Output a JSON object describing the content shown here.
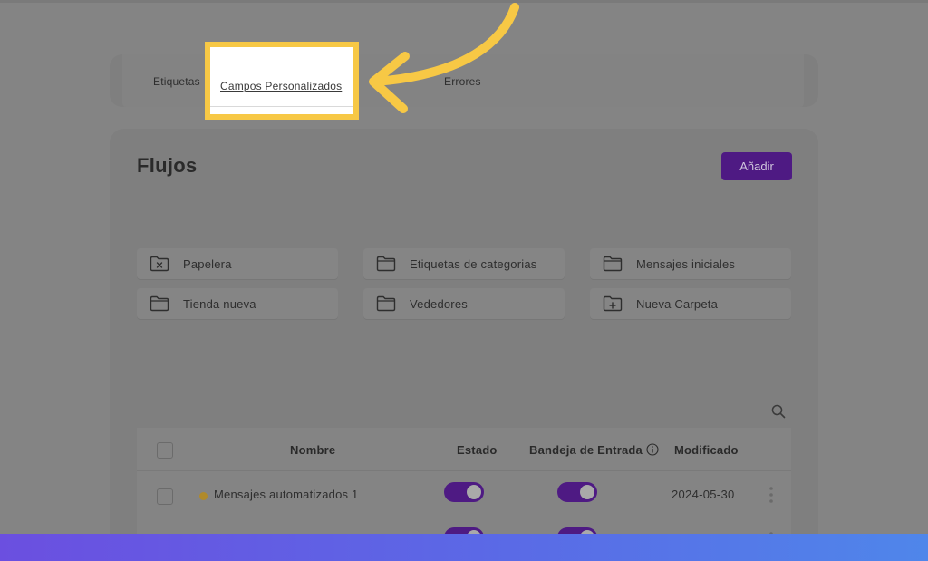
{
  "tabs": {
    "items": [
      {
        "label": "Etiquetas"
      },
      {
        "label": "Campos Personalizados"
      },
      {
        "label": "Errores"
      }
    ],
    "highlighted": "Campos Personalizados"
  },
  "main": {
    "title": "Flujos",
    "add_label": "Añadir",
    "folders": [
      {
        "label": "Papelera",
        "icon": "folder-x-icon"
      },
      {
        "label": "Etiquetas de categorias",
        "icon": "folder-icon"
      },
      {
        "label": "Mensajes iniciales",
        "icon": "folder-icon"
      },
      {
        "label": "Tienda nueva",
        "icon": "folder-icon"
      },
      {
        "label": "Vededores",
        "icon": "folder-icon"
      },
      {
        "label": "Nueva Carpeta",
        "icon": "folder-plus-icon"
      }
    ]
  },
  "table": {
    "columns": {
      "nombre": "Nombre",
      "estado": "Estado",
      "bandeja": "Bandeja de Entrada",
      "modificado": "Modificado"
    },
    "rows": [
      {
        "name": "Mensajes automatizados 1",
        "status_color": "#b08a2b",
        "estado_on": true,
        "bandeja_on": true,
        "modified": "2024-05-30"
      },
      {
        "name": "",
        "estado_on": true,
        "bandeja_on": true,
        "modified": ""
      }
    ]
  },
  "colors": {
    "accent": "#4e1a83",
    "highlight": "#f7c845",
    "status_dot": "#b08a2b"
  }
}
